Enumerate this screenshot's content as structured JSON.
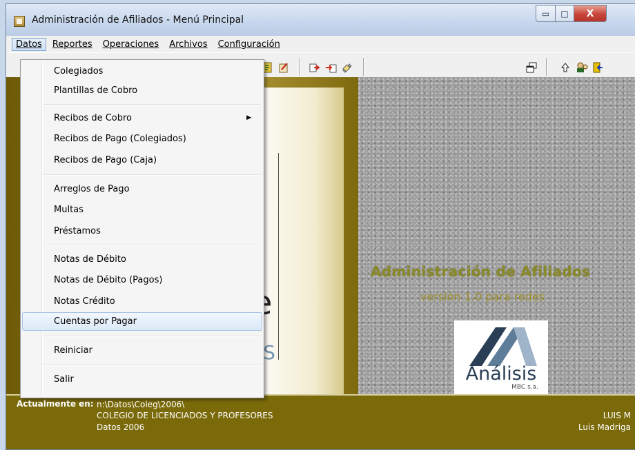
{
  "window": {
    "title": "Administración de Afiliados - Menú Principal",
    "minimize_glyph": "▭",
    "maximize_glyph": "□",
    "close_glyph": "X"
  },
  "menubar": [
    "Datos",
    "Reportes",
    "Operaciones",
    "Archivos",
    "Configuración"
  ],
  "toolbar": {
    "icons": [
      "report-icon",
      "edit-icon",
      "export-icon",
      "import-icon",
      "clip-icon",
      "window-icon",
      "up-arrow-icon",
      "users-icon",
      "exit-icon"
    ]
  },
  "datos_menu": [
    {
      "label": "Colegiados"
    },
    {
      "label": "Plantillas de Cobro"
    },
    {
      "label": "Recibos de Cobro",
      "submenu": true
    },
    {
      "label": "Recibos de Pago (Colegiados)"
    },
    {
      "label": "Recibos de Pago (Caja)"
    },
    {
      "label": "Arreglos de Pago"
    },
    {
      "label": "Multas"
    },
    {
      "label": "Préstamos"
    },
    {
      "label": "Notas de Débito"
    },
    {
      "label": "Notas de Débito (Pagos)"
    },
    {
      "label": "Notas Crédito"
    },
    {
      "label": "Cuentas por Pagar",
      "highlighted": true
    },
    {
      "label": "Reiniciar"
    },
    {
      "label": "Salir"
    }
  ],
  "splash": {
    "card_letter": "e",
    "card_fragment_top": "VS",
    "card_fragment_bottom": "e",
    "app_name": "Administración de Afiliados",
    "version": "versión 1.0 para redes",
    "logo_brand": "Análisis",
    "logo_sub": "MBC s.a."
  },
  "status": {
    "label": "Actualmente en:",
    "path": "n:\\Datos\\Coleg\\2006\\",
    "organization": "COLEGIO DE LICENCIADOS Y PROFESORES",
    "dataset": "Datos 2006",
    "user_short": "LUIS M",
    "user_full": "Luis Madriga"
  },
  "colors": {
    "gold": "#7a6a0a",
    "granite": "#9b9b9b",
    "menu_highlight": "#dce9f8"
  }
}
